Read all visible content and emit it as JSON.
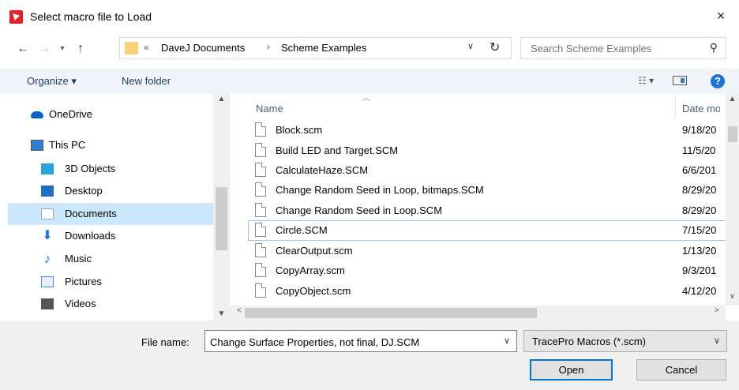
{
  "window": {
    "title": "Select macro file to Load",
    "close_icon": "×"
  },
  "address": {
    "overflow_chevron": "«",
    "crumbs": [
      "DaveJ Documents",
      "Scheme Examples"
    ],
    "separator": "›"
  },
  "search": {
    "placeholder": "Search Scheme Examples"
  },
  "toolbar": {
    "organize_label": "Organize ▾",
    "new_folder_label": "New folder",
    "help_label": "?"
  },
  "nav_pane": {
    "items": [
      {
        "label": "OneDrive",
        "icon": "onedrive-icon",
        "color": "#0a64c8"
      },
      {
        "label": "This PC",
        "icon": "computer-icon",
        "color": "#2f7fd1"
      },
      {
        "label": "3D Objects",
        "icon": "cube-icon",
        "color": "#2aa3d8"
      },
      {
        "label": "Desktop",
        "icon": "desktop-icon",
        "color": "#1f6ec4"
      },
      {
        "label": "Documents",
        "icon": "documents-icon",
        "color": "#9aa6b2"
      },
      {
        "label": "Downloads",
        "icon": "download-arrow-icon",
        "color": "#1a73d9"
      },
      {
        "label": "Music",
        "icon": "music-note-icon",
        "color": "#1a73d9"
      },
      {
        "label": "Pictures",
        "icon": "pictures-icon",
        "color": "#4a8ad8"
      },
      {
        "label": "Videos",
        "icon": "film-icon",
        "color": "#555555"
      }
    ],
    "selected": "Documents"
  },
  "file_list": {
    "columns": {
      "name": "Name",
      "date": "Date modified"
    },
    "files": [
      {
        "name": "Block.scm",
        "date": "9/18/20"
      },
      {
        "name": "Build LED and Target.SCM",
        "date": "11/5/20"
      },
      {
        "name": "CalculateHaze.SCM",
        "date": "6/6/201"
      },
      {
        "name": "Change Random Seed in Loop, bitmaps.SCM",
        "date": "8/29/20"
      },
      {
        "name": "Change Random Seed in Loop.SCM",
        "date": "8/29/20"
      },
      {
        "name": "Circle.SCM",
        "date": "7/15/20"
      },
      {
        "name": "ClearOutput.scm",
        "date": "1/13/20"
      },
      {
        "name": "CopyArray.scm",
        "date": "9/3/201"
      },
      {
        "name": "CopyObject.scm",
        "date": "4/12/20"
      }
    ],
    "focused": "Circle.SCM"
  },
  "footer": {
    "filename_label": "File name:",
    "filename_value": "Change Surface Properties, not final, DJ.SCM",
    "filetype_value": "TracePro Macros (*.scm)",
    "open_label": "Open",
    "cancel_label": "Cancel"
  }
}
